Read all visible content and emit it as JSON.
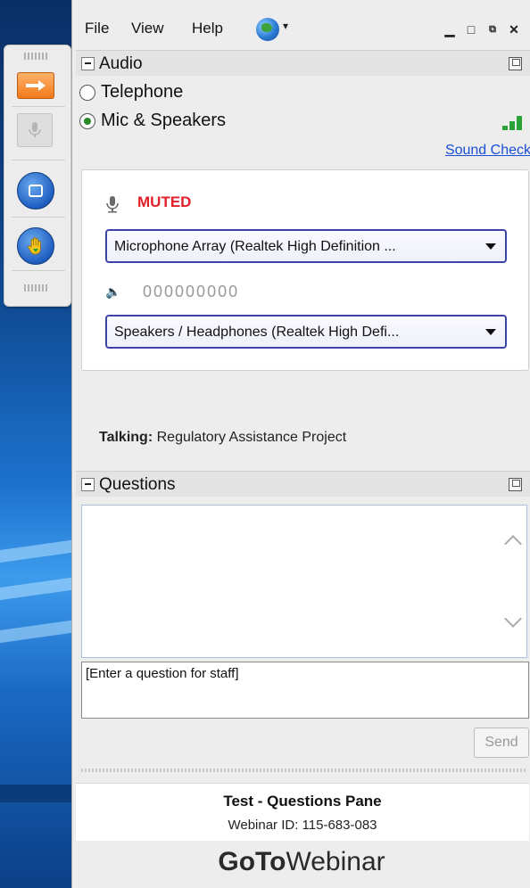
{
  "menu": {
    "file": "File",
    "view": "View",
    "help": "Help"
  },
  "audio": {
    "title": "Audio",
    "telephone_label": "Telephone",
    "mic_label": "Mic & Speakers",
    "sound_check": "Sound Check",
    "muted_label": "MUTED",
    "microphone_device": "Microphone Array (Realtek High Definition ...",
    "level_display": "000000000",
    "speaker_device": "Speakers / Headphones (Realtek High Defi...",
    "talking_label": "Talking:",
    "talking_name": "Regulatory Assistance Project"
  },
  "questions": {
    "title": "Questions",
    "input_placeholder": "[Enter a question for staff]",
    "send_label": "Send"
  },
  "footer": {
    "webinar_title": "Test - Questions Pane",
    "webinar_id": "Webinar ID: 115-683-083",
    "brand_goto": "GoTo",
    "brand_webinar": "Webinar"
  },
  "colors": {
    "muted": "#e3202a",
    "link": "#1a4fd6",
    "level_bars": "#2aa33a",
    "dropdown_border": "#3c44a8"
  },
  "icons": [
    "arrow-icon",
    "microphone-icon",
    "screen-icon",
    "raise-hand-icon",
    "globe-icon",
    "speaker-icon",
    "popout-icon",
    "scroll-up-icon",
    "scroll-down-icon"
  ]
}
